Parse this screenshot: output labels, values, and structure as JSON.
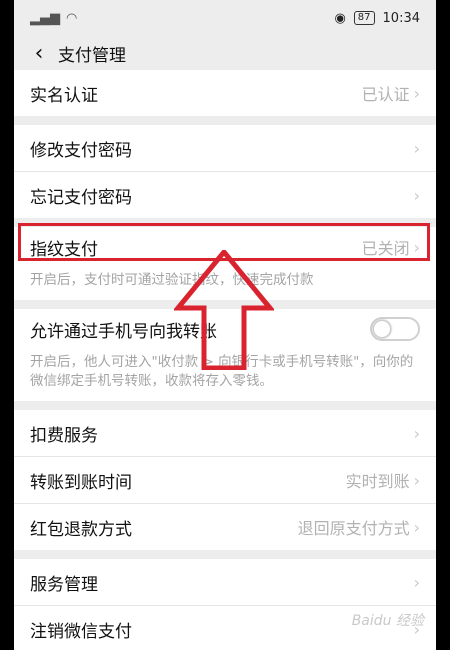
{
  "status": {
    "time": "10:34",
    "battery": "87"
  },
  "header": {
    "title": "支付管理"
  },
  "sections": {
    "realname": {
      "label": "实名认证",
      "value": "已认证"
    },
    "modify_pwd": {
      "label": "修改支付密码"
    },
    "forget_pwd": {
      "label": "忘记支付密码"
    },
    "fingerprint": {
      "label": "指纹支付",
      "value": "已关闭",
      "desc": "开启后，支付时可通过验证指纹，快速完成付款"
    },
    "phone_transfer": {
      "label": "允许通过手机号向我转账",
      "desc": "开启后，他人可进入\"收付款 > 向银行卡或手机号转账\"，向你的微信绑定手机号转账，收款将存入零钱。",
      "enabled": false
    },
    "deduct": {
      "label": "扣费服务"
    },
    "transfer_time": {
      "label": "转账到账时间",
      "value": "实时到账"
    },
    "refund": {
      "label": "红包退款方式",
      "value": "退回原支付方式"
    },
    "service_mgmt": {
      "label": "服务管理"
    },
    "logout": {
      "label": "注销微信支付"
    }
  },
  "watermark": "Baidu 经验",
  "colors": {
    "highlight": "#d9242f",
    "background": "#ededed"
  }
}
